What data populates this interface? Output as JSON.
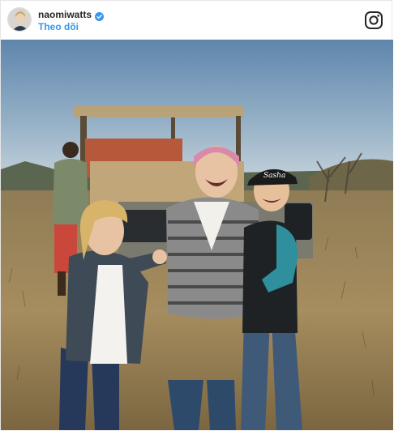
{
  "post": {
    "username": "naomiwatts",
    "verified": true,
    "follow_label": "Theo dõi",
    "platform_icon": "instagram-icon",
    "photo": {
      "description_icon": "photo",
      "cap_text": "Sasha"
    }
  },
  "colors": {
    "username": "#262626",
    "follow": "#3897f0",
    "verified": "#3897f0",
    "sky_top": "#5e86ad",
    "sky_bottom": "#cfdbe3",
    "grass": "#a08a5c"
  }
}
